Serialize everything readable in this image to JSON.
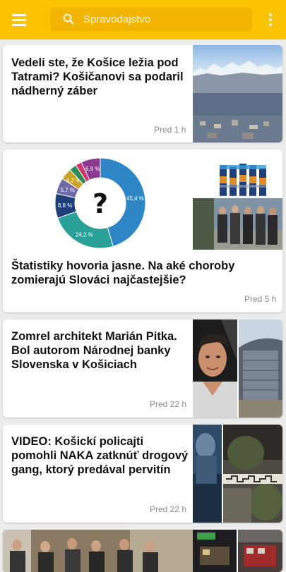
{
  "header": {
    "search_placeholder": "Spravodajstvo"
  },
  "articles": [
    {
      "title": "Vedeli ste, že Košice ležia pod Tatrami? Košičanovi sa podaril nádherný záber",
      "time": "Pred 1 h"
    },
    {
      "title": "Štatistiky hovoria jasne. Na aké choroby zomierajú Slováci najčastejšie?",
      "time": "Pred 5 h"
    },
    {
      "title": "Zomrel architekt Marián Pitka. Bol autorom Národnej banky Slovenska v Košiciach",
      "time": "Pred 22 h"
    },
    {
      "title": "VIDEO: Košickí policajti pomohli NAKA zatknúť drogový gang, ktorý predával pervitín",
      "time": "Pred 22 h"
    }
  ],
  "chart_data": {
    "type": "pie",
    "title": "",
    "labels": [
      "45,4 %",
      "24,2 %",
      "8,8 %",
      "5,7 %",
      "4,2 %",
      "",
      "",
      "6,9 %"
    ],
    "values": [
      45.4,
      24.2,
      8.8,
      5.7,
      4.2,
      2.6,
      2.2,
      6.9
    ],
    "colors": [
      "#2f86c6",
      "#2aa198",
      "#1f3f7a",
      "#6f6aa8",
      "#c9a227",
      "#2e8b57",
      "#d2336e",
      "#8b3a8f"
    ],
    "center_glyph": "?"
  }
}
